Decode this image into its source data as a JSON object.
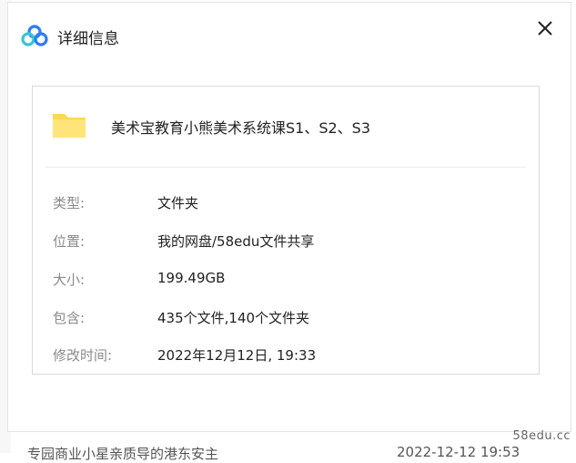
{
  "dialog": {
    "title": "详细信息",
    "file_name": "美术宝教育小熊美术系统课S1、S2、S3",
    "rows": [
      {
        "label": "类型:",
        "value": "文件夹"
      },
      {
        "label": "位置:",
        "value": "我的网盘/58edu文件共享"
      },
      {
        "label": "大小:",
        "value": "199.49GB"
      },
      {
        "label": "包含:",
        "value": "435个文件,140个文件夹"
      },
      {
        "label": "修改时间:",
        "value": "2022年12月12日, 19:33"
      }
    ]
  },
  "background": {
    "bottom_text": "专园商业小星亲质导的港东安主",
    "bottom_date": "2022-12-12 19:53"
  },
  "watermark": "58edu.cc",
  "colors": {
    "folder": "#ffd84d",
    "logo_blue": "#2f7cf6",
    "logo_cyan": "#36c6d6"
  }
}
